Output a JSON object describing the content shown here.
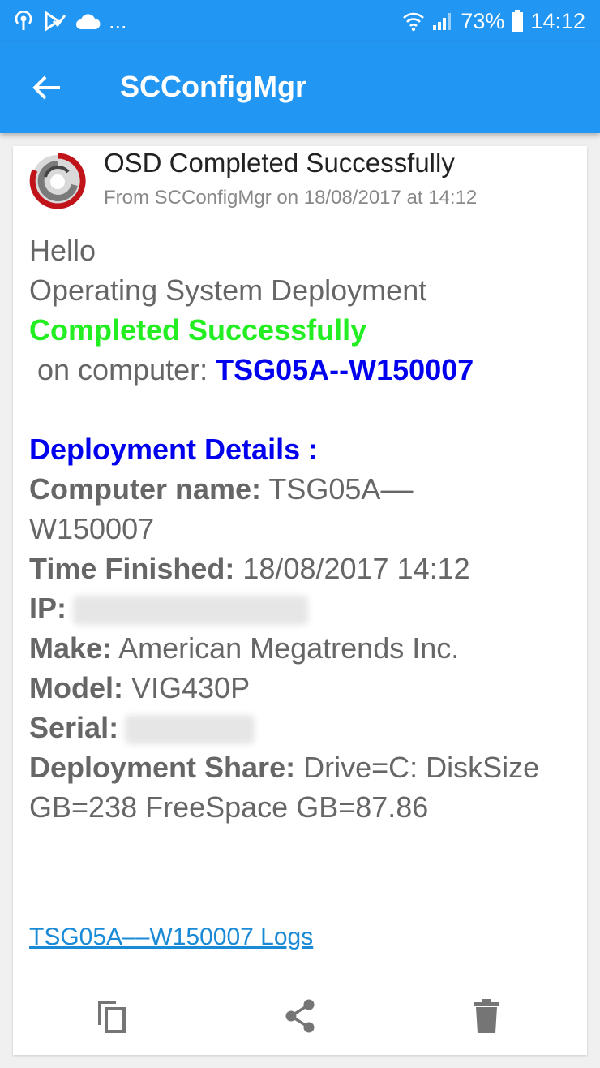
{
  "status_bar": {
    "battery": "73%",
    "time": "14:12",
    "dots": "...",
    "icons": [
      "hotspot-icon",
      "check-icon",
      "cloud-icon",
      "wifi-icon",
      "signal-icon",
      "battery-icon"
    ]
  },
  "appbar": {
    "title": "SCConfigMgr",
    "back_icon": "arrow-left-icon",
    "color": "#2196f3"
  },
  "notification": {
    "subject": "OSD Completed Successfully",
    "from": "From SCConfigMgr on 18/08/2017 at 14:12",
    "body": {
      "greeting": "Hello",
      "line1": "Operating System Deployment",
      "status": "Completed Successfully",
      "on_computer_label": " on computer: ",
      "computer": "TSG05A--W150007",
      "details_heading": "Deployment Details :",
      "computer_name_label": "Computer name:",
      "computer_name_value": " TSG05A–– W150007",
      "time_finished_label": "Time Finished:",
      "time_finished_value": " 18/08/2017 14:12",
      "ip_label": "IP:",
      "make_label": "Make:",
      "make_value": " American Megatrends Inc.",
      "model_label": "Model:",
      "model_value": " VIG430P",
      "serial_label": "Serial:",
      "share_label": "Deployment Share:",
      "share_value": " Drive=C: DiskSize GB=238 FreeSpace GB=87.86"
    },
    "logs_link": "TSG05A––W150007 Logs",
    "actions": [
      {
        "name": "copy",
        "icon": "copy-icon"
      },
      {
        "name": "share",
        "icon": "share-icon"
      },
      {
        "name": "delete",
        "icon": "trash-icon"
      }
    ],
    "colors": {
      "status_green": "#22ee22",
      "link_blue": "#0000ee",
      "hyperlink": "#1a8ad6"
    }
  }
}
